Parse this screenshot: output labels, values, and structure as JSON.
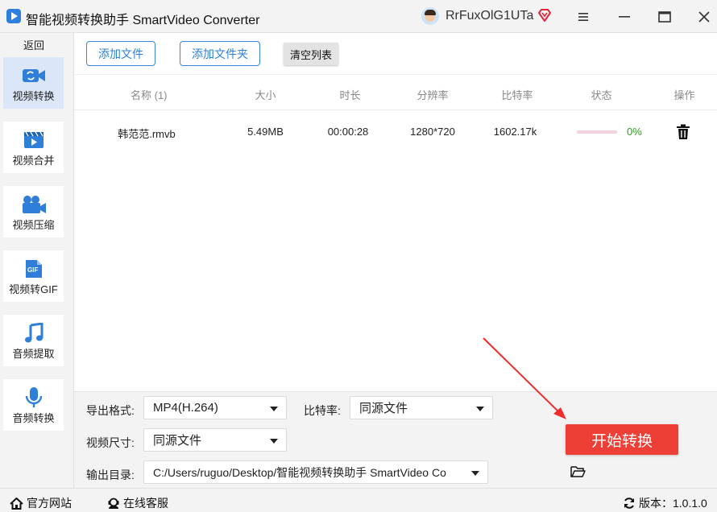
{
  "window": {
    "title": "智能视频转换助手 SmartVideo Converter",
    "username": "RrFuxOlG1UTa"
  },
  "sidebar": {
    "back_label": "返回",
    "items": [
      {
        "label": "视频转换",
        "icon": "video-convert-icon",
        "active": true
      },
      {
        "label": "视频合并",
        "icon": "video-merge-icon",
        "active": false
      },
      {
        "label": "视频压缩",
        "icon": "video-compress-icon",
        "active": false
      },
      {
        "label": "视频转GIF",
        "icon": "gif-icon",
        "active": false
      },
      {
        "label": "音频提取",
        "icon": "music-note-icon",
        "active": false
      },
      {
        "label": "音频转换",
        "icon": "microphone-icon",
        "active": false
      }
    ]
  },
  "toolbar": {
    "add_file": "添加文件",
    "add_folder": "添加文件夹",
    "clear_list": "清空列表"
  },
  "table": {
    "headers": {
      "name": "名称 (1)",
      "size": "大小",
      "duration": "时长",
      "resolution": "分辨率",
      "bitrate": "比特率",
      "status": "状态",
      "action": "操作"
    },
    "rows": [
      {
        "name": "韩范范.rmvb",
        "size": "5.49MB",
        "duration": "00:00:28",
        "resolution": "1280*720",
        "bitrate": "1602.17k",
        "progress": 0,
        "progress_text": "0%"
      }
    ]
  },
  "settings": {
    "format_label": "导出格式:",
    "format_value": "MP4(H.264)",
    "bitrate_label": "比特率:",
    "bitrate_value": "同源文件",
    "size_label": "视频尺寸:",
    "size_value": "同源文件",
    "output_label": "输出目录:",
    "output_value": "C:/Users/ruguo/Desktop/智能视频转换助手 SmartVideo Co"
  },
  "start_button": "开始转换",
  "footer": {
    "website": "官方网站",
    "support": "在线客服",
    "version": "版本：1.0.1.0"
  },
  "colors": {
    "accent": "#2f7fd9",
    "start": "#ed3f35",
    "progress_track": "#f0d3de",
    "progress_text": "#2aa01e",
    "active_sidebar": "#dbe6f8"
  }
}
